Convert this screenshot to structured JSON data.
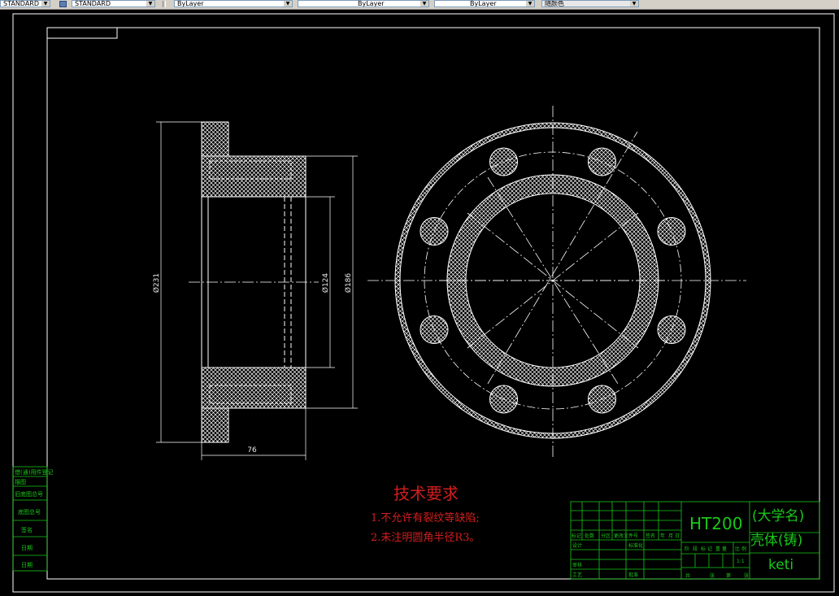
{
  "toolbar": {
    "text_style_label": "STANDARD",
    "color_label": "ByLayer",
    "linetype_label": "ByLayer",
    "lineweight_label": "ByLayer",
    "plotstyle_label": "随颜色"
  },
  "drawing": {
    "section_view": {
      "dim_outer_diameter": "Ø231",
      "dim_bore_diameter": "Ø124",
      "dim_hub_diameter": "Ø186",
      "dim_length": "76"
    },
    "tech_requirements": {
      "title": "技术要求",
      "items": [
        "1.不允许有裂纹等缺陷;",
        "2.未注明圆角半径R3。"
      ]
    },
    "side_table": [
      "旧底图总号",
      "底图总号",
      "签名",
      "日期",
      "日期",
      "借(通)用件登记",
      "描图"
    ],
    "title_block": {
      "material": "HT200",
      "school": "(大学名)",
      "part_name": "壳体(铸)",
      "drawing_no": "keti",
      "scale": "1:1",
      "row_labels": [
        "标记",
        "处数",
        "分区",
        "更改文件号",
        "签名",
        "年",
        "月",
        "日"
      ],
      "left_labels": [
        "设计",
        "标准化",
        "审核",
        "工艺",
        "批准"
      ],
      "sheet_labels": [
        "共",
        "张",
        "第",
        "张"
      ],
      "stage_labels": [
        "阶",
        "段",
        "标",
        "记",
        "重",
        "量",
        "比",
        "例"
      ]
    }
  },
  "colors": {
    "background": "#000000",
    "lines": "#ffffff",
    "text_red": "#d21e1e",
    "text_green": "#19c819"
  }
}
